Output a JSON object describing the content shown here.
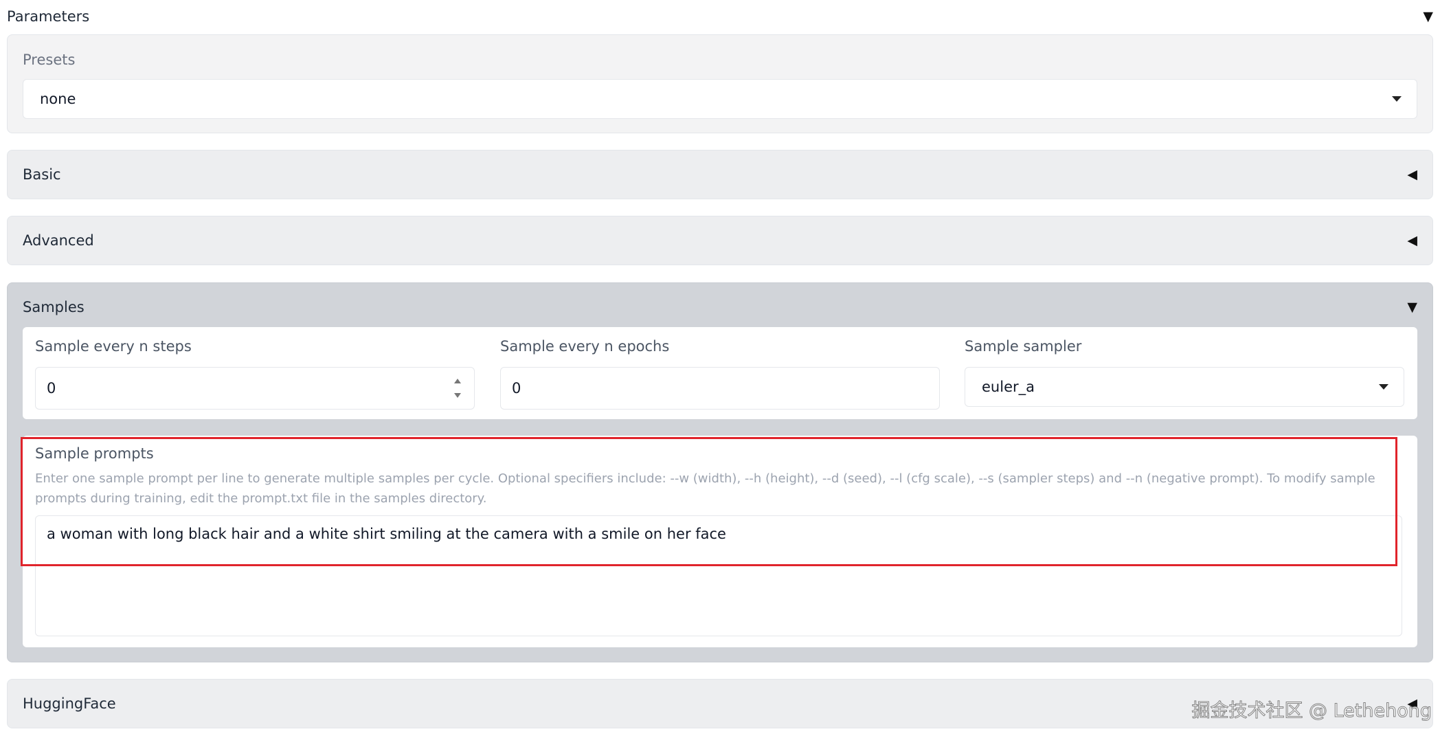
{
  "parameters": {
    "title": "Parameters",
    "toggle_icon": "triangle-down-icon"
  },
  "presets": {
    "label": "Presets",
    "selected": "none"
  },
  "sections": {
    "basic": {
      "title": "Basic",
      "toggle_icon": "triangle-left-icon"
    },
    "advanced": {
      "title": "Advanced",
      "toggle_icon": "triangle-left-icon"
    },
    "huggingface": {
      "title": "HuggingFace",
      "toggle_icon": "triangle-left-icon"
    }
  },
  "samples": {
    "title": "Samples",
    "toggle_icon": "triangle-down-icon",
    "every_n_steps": {
      "label": "Sample every n steps",
      "value": "0"
    },
    "every_n_epochs": {
      "label": "Sample every n epochs",
      "value": "0"
    },
    "sampler": {
      "label": "Sample sampler",
      "selected": "euler_a"
    },
    "prompts": {
      "label": "Sample prompts",
      "info": "Enter one sample prompt per line to generate multiple samples per cycle. Optional specifiers include: --w (width), --h (height), --d (seed), --l (cfg scale), --s (sampler steps) and --n (negative prompt). To modify sample prompts during training, edit the prompt.txt file in the samples directory.",
      "value": "a woman with long black hair and a white shirt smiling at the camera with a smile on her face"
    }
  },
  "watermark": "掘金技术社区 @ Lethehong",
  "colors": {
    "highlight": "#e0242b",
    "open_panel": "#d1d4d9",
    "collapsed_panel": "#edeef0"
  }
}
